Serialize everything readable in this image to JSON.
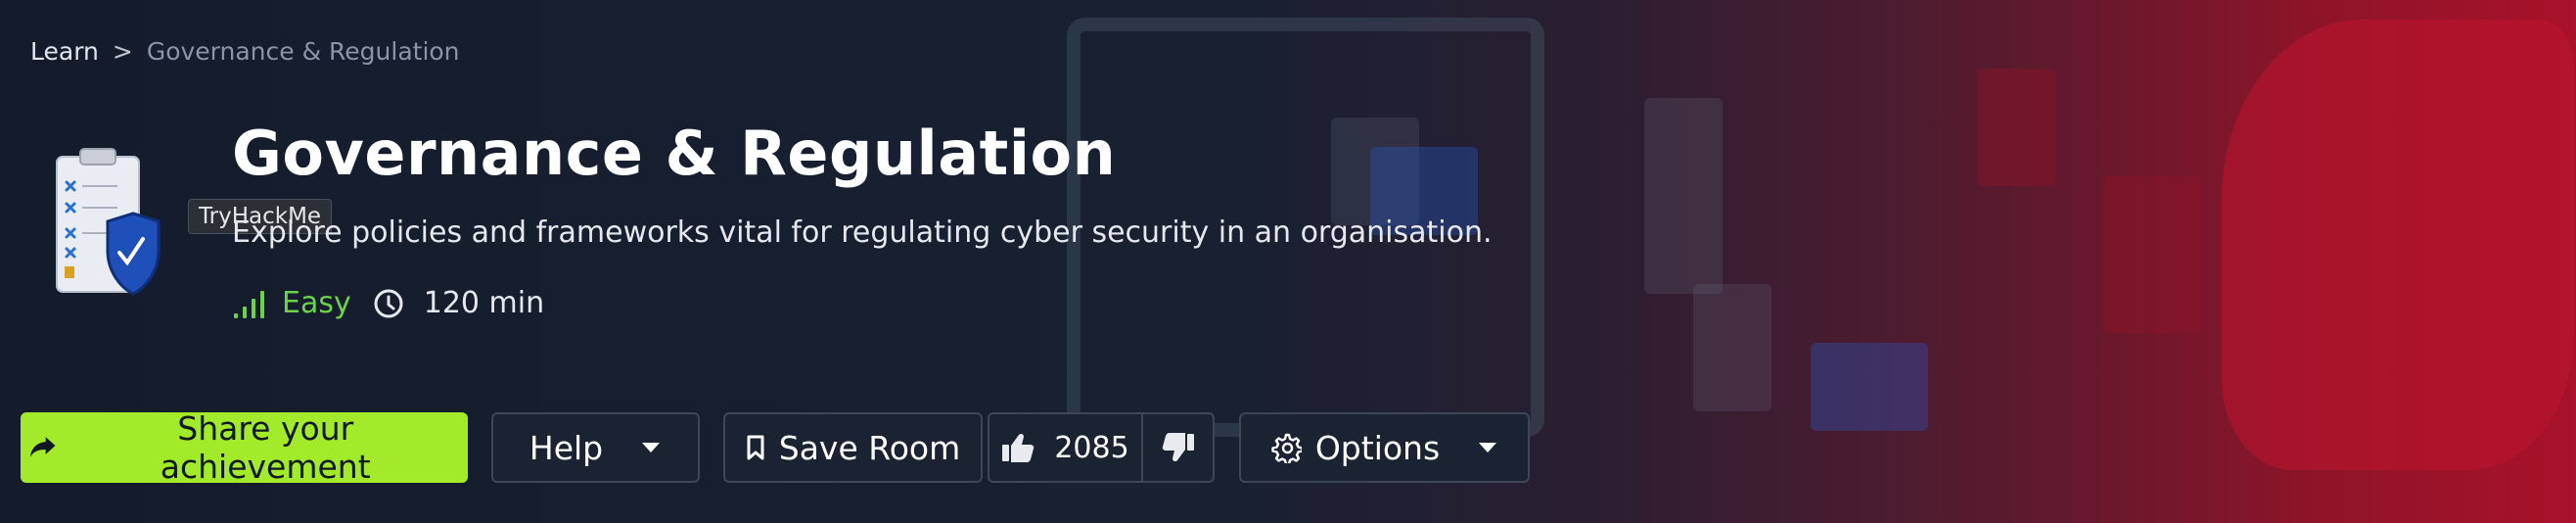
{
  "breadcrumb": {
    "items": [
      "Learn",
      "Governance & Regulation"
    ],
    "separator": ">"
  },
  "tooltip": {
    "text": "TryHackMe"
  },
  "room": {
    "title": "Governance & Regulation",
    "description": "Explore policies and frameworks vital for regulating cyber security in an organisation.",
    "difficulty": "Easy",
    "duration": "120 min",
    "icon": "checklist-shield-icon"
  },
  "actions": {
    "share_label": "Share your achievement",
    "help_label": "Help",
    "save_label": "Save Room",
    "upvotes": "2085",
    "options_label": "Options"
  },
  "colors": {
    "primary": "#a3ea2a",
    "difficulty_easy": "#6bd34a",
    "background_dark": "#141c2c",
    "accent_red": "#a8122a"
  }
}
